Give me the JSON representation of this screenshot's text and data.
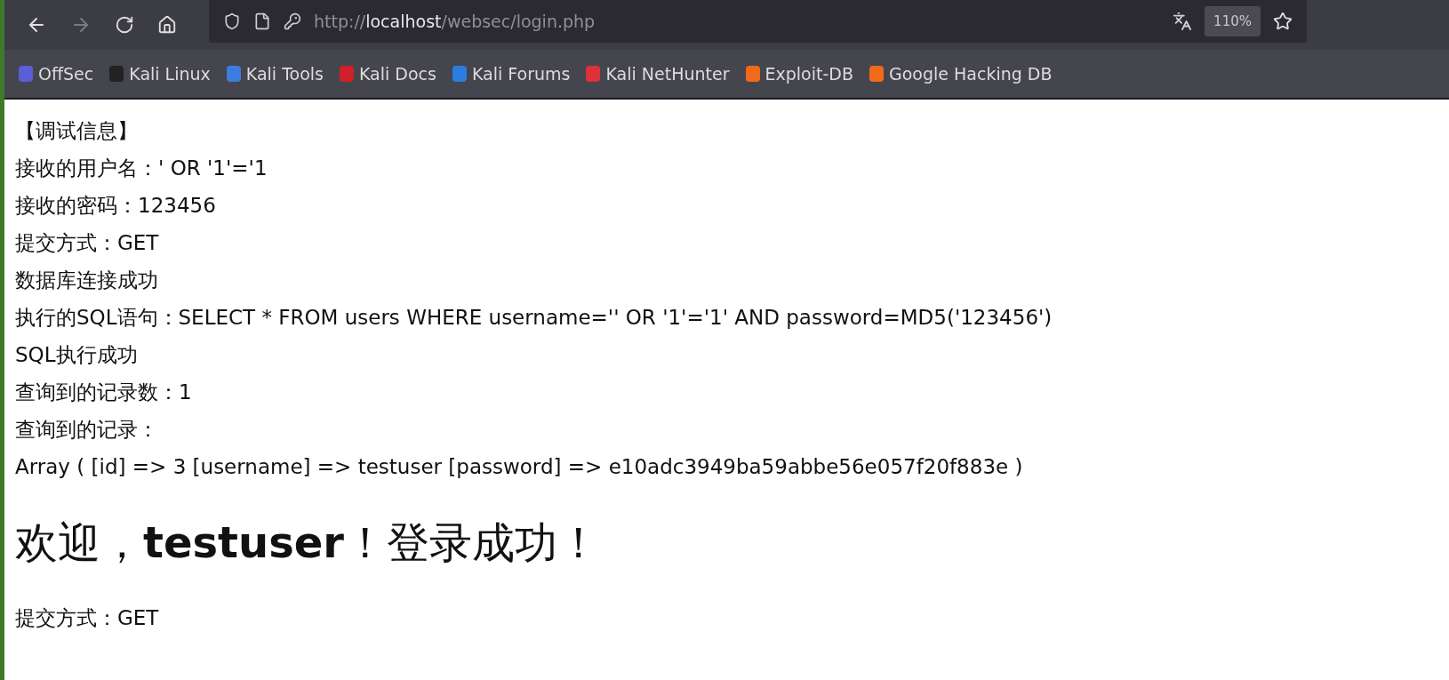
{
  "toolbar": {
    "url": {
      "prefix": "http://",
      "host": "localhost",
      "path": "/websec/login.php"
    },
    "zoom": "110%"
  },
  "bookmarks": [
    {
      "label": "OffSec",
      "color": "#5a5fd8"
    },
    {
      "label": "Kali Linux",
      "color": "#222222"
    },
    {
      "label": "Kali Tools",
      "color": "#3b7de0"
    },
    {
      "label": "Kali Docs",
      "color": "#d0202a"
    },
    {
      "label": "Kali Forums",
      "color": "#2a7ee0"
    },
    {
      "label": "Kali NetHunter",
      "color": "#e0303a"
    },
    {
      "label": "Exploit-DB",
      "color": "#f06a1a"
    },
    {
      "label": "Google Hacking DB",
      "color": "#f06a1a"
    }
  ],
  "debug_lines": [
    "【调试信息】",
    "接收的用户名：' OR '1'='1",
    "接收的密码：123456",
    "提交方式：GET",
    "数据库连接成功",
    "执行的SQL语句：SELECT * FROM users WHERE username='' OR '1'='1' AND password=MD5('123456')",
    "SQL执行成功",
    "查询到的记录数：1",
    "查询到的记录：",
    "Array ( [id] => 3 [username] => testuser [password] => e10adc3949ba59abbe56e057f20f883e )"
  ],
  "welcome_heading": "欢迎，**testuser**！登录成功！",
  "footer_line": "提交方式：GET"
}
